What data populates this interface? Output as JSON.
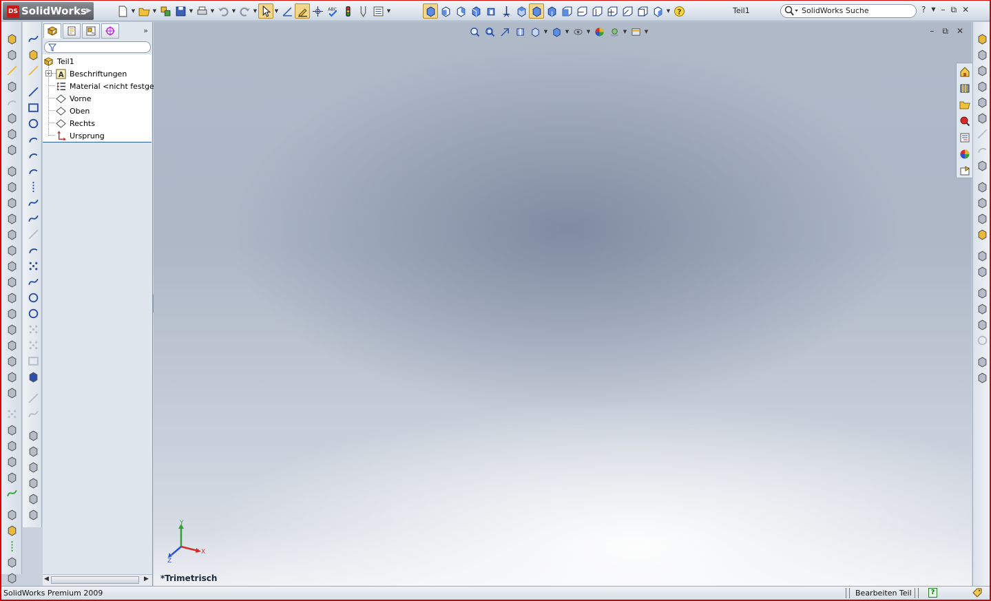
{
  "app": {
    "name": "SolidWorks",
    "document_title": "Teil1"
  },
  "search": {
    "placeholder": "SolidWorks Suche"
  },
  "title_buttons": {
    "help": "?",
    "minimize": "–",
    "restore": "⧉",
    "close": "✕"
  },
  "feature_tree": {
    "root": "Teil1",
    "items": [
      {
        "label": "Beschriftungen",
        "icon": "annotations-icon"
      },
      {
        "label": "Material <nicht festgelegt>",
        "icon": "material-icon"
      },
      {
        "label": "Vorne",
        "icon": "plane-icon"
      },
      {
        "label": "Oben",
        "icon": "plane-icon"
      },
      {
        "label": "Rechts",
        "icon": "plane-icon"
      },
      {
        "label": "Ursprung",
        "icon": "origin-icon"
      }
    ]
  },
  "graphics": {
    "view_name": "*Trimetrisch",
    "axes": {
      "x": "X",
      "y": "Y",
      "z": "Z"
    }
  },
  "status_bar": {
    "product": "SolidWorks Premium 2009",
    "mode": "Bearbeiten Teil",
    "help": "?"
  },
  "colors": {
    "frame_border": "#d40000",
    "axis_x": "#d62b2b",
    "axis_y": "#2fa52f",
    "axis_z": "#2b4fd6",
    "selection": "#f2d68b"
  }
}
